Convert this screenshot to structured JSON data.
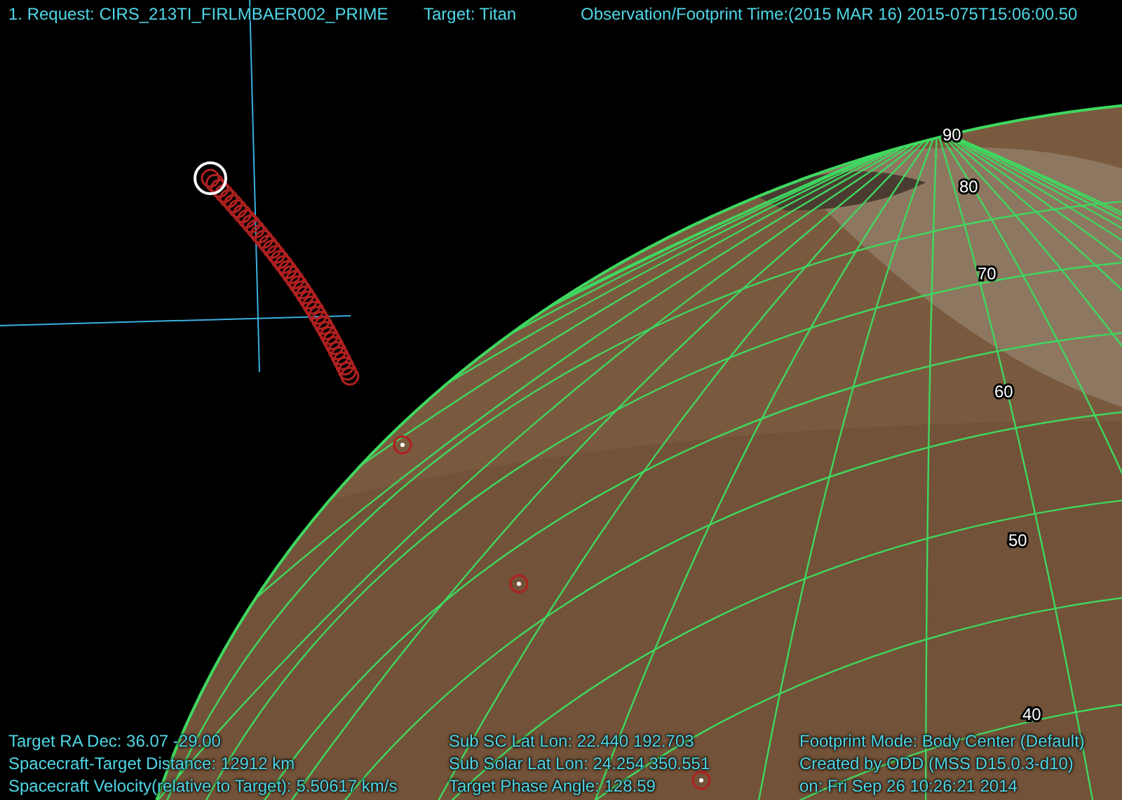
{
  "header": {
    "request": "1. Request: CIRS_213TI_FIRLMBAER002_PRIME",
    "target": "Target: Titan",
    "time": "Observation/Footprint Time:(2015 MAR 16) 2015-075T15:06:00.50"
  },
  "latitude_labels": [
    "90",
    "80",
    "70",
    "60",
    "50",
    "40"
  ],
  "footer": {
    "columns": [
      [
        "Target RA Dec: 36.07  -29.00",
        "Spacecraft-Target Distance:   12912 km",
        "Spacecraft Velocity(relative to Target): 5.50617 km/s"
      ],
      [
        "Sub SC Lat Lon: 22.440  192.703",
        "Sub Solar Lat Lon: 24.254  350.551",
        "Target Phase Angle: 128.59"
      ],
      [
        "Footprint Mode: Body Center (Default)",
        "Created by ODD (MSS D15.0.3-d10)",
        "on: Fri Sep 26 10:26:21 2014"
      ]
    ]
  }
}
